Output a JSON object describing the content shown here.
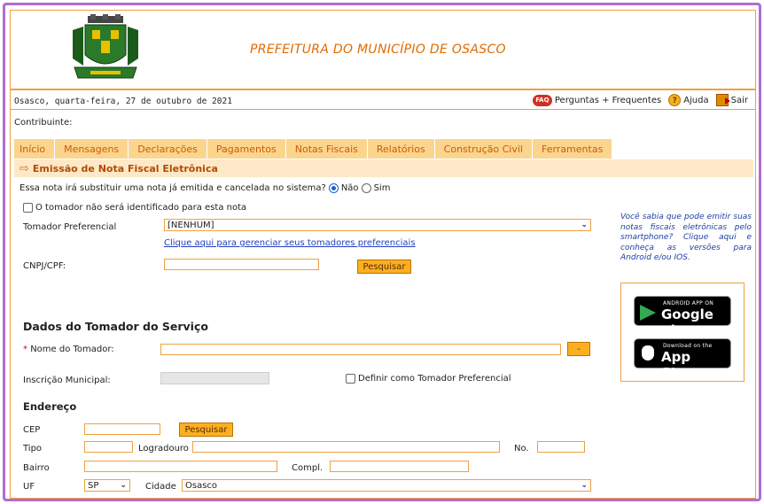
{
  "header": {
    "site_title": "PREFEITURA DO MUNICÍPIO DE OSASCO",
    "date": "Osasco, quarta-feira, 27 de outubro de 2021",
    "links": {
      "faq": "Perguntas + Frequentes",
      "help": "Ajuda",
      "exit": "Sair"
    },
    "contributor_label": "Contribuinte:"
  },
  "nav": [
    "Início",
    "Mensagens",
    "Declarações",
    "Pagamentos",
    "Notas Fiscais",
    "Relatórios",
    "Construção Civil",
    "Ferramentas"
  ],
  "section_title": "Emissão de Nota Fiscal Eletrônica",
  "replace_question": {
    "text": "Essa nota irá substituir uma nota já emitida e cancelada no sistema?",
    "option_no": "Não",
    "option_yes": "Sim",
    "selected": "Não"
  },
  "form": {
    "unidentified_checkbox_label": "O tomador não será identificado para esta nota",
    "preferred_label": "Tomador Preferencial",
    "preferred_value": "[NENHUM]",
    "manage_link": "Clique aqui para gerenciar seus tomadores preferenciais",
    "cnpj_label": "CNPJ/CPF:",
    "search_button": "Pesquisar"
  },
  "tomador": {
    "heading": "Dados do Tomador do Serviço",
    "required_mark": "*",
    "name_label": "Nome do Tomador:",
    "name_button": "-",
    "im_label": "Inscrição Municipal:",
    "define_pref_label": "Definir como Tomador Preferencial"
  },
  "address": {
    "heading": "Endereço",
    "cep_label": "CEP",
    "cep_button": "Pesquisar",
    "tipo_label": "Tipo",
    "logradouro_label": "Logradouro",
    "no_label": "No.",
    "bairro_label": "Bairro",
    "compl_label": "Compl.",
    "uf_label": "UF",
    "uf_value": "SP",
    "cidade_label": "Cidade",
    "cidade_value": "Osasco"
  },
  "promo": {
    "text": "Você sabia que pode emitir suas notas fiscais eletrônicas pelo smartphone? Clique aqui e conheça as versões para Android e/ou IOS.",
    "google_small": "ANDROID APP ON",
    "google_big": "Google play",
    "apple_small": "Download on the",
    "apple_big": "App Store"
  },
  "colors": {
    "accent": "#f0a040",
    "title": "#e06b00",
    "nav_bg": "#fbd58e",
    "frame": "#b06cd0"
  }
}
